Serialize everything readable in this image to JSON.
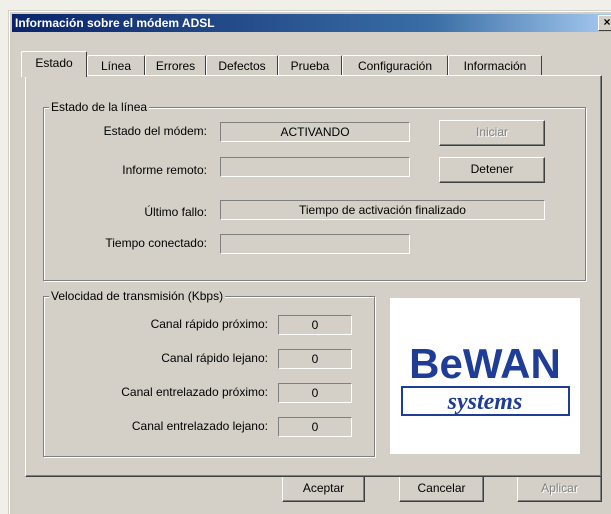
{
  "window": {
    "title": "Información sobre el módem ADSL",
    "close_glyph": "×"
  },
  "tabs": [
    {
      "label": "Estado"
    },
    {
      "label": "Línea"
    },
    {
      "label": "Errores"
    },
    {
      "label": "Defectos"
    },
    {
      "label": "Prueba"
    },
    {
      "label": "Configuración"
    },
    {
      "label": "Información"
    }
  ],
  "line_state": {
    "legend": "Estado de la línea",
    "modem_state_label": "Estado del módem:",
    "modem_state_value": "ACTIVANDO",
    "remote_report_label": "Informe remoto:",
    "remote_report_value": "",
    "last_fault_label": "Último fallo:",
    "last_fault_value": "Tiempo de activación finalizado",
    "connected_time_label": "Tiempo conectado:",
    "connected_time_value": "",
    "start_button": "Iniciar",
    "stop_button": "Detener"
  },
  "speed": {
    "legend": "Velocidad de transmisión (Kbps)",
    "fast_near_label": "Canal rápido próximo:",
    "fast_near_value": "0",
    "fast_far_label": "Canal rápido lejano:",
    "fast_far_value": "0",
    "interleaved_near_label": "Canal entrelazado próximo:",
    "interleaved_near_value": "0",
    "interleaved_far_label": "Canal entrelazado lejano:",
    "interleaved_far_value": "0"
  },
  "logo": {
    "line1": "BeWAN",
    "line2": "systems",
    "brand_color": "#1f3c96"
  },
  "footer": {
    "accept": "Aceptar",
    "cancel": "Cancelar",
    "apply": "Aplicar"
  }
}
